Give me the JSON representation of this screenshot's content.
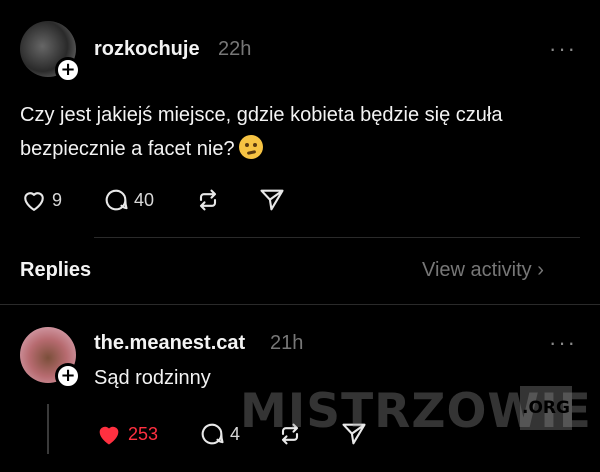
{
  "post": {
    "username": "rozkochuje",
    "time": "22h",
    "text": "Czy jest jakiejś miejsce, gdzie kobieta będzie się czuła bezpiecznie a facet nie?",
    "emoji": "thinking-face",
    "likes": "9",
    "comments": "40",
    "more_label": "···"
  },
  "replies_header": {
    "label": "Replies",
    "view_activity": "View activity ›"
  },
  "reply": {
    "username": "the.meanest.cat",
    "time": "21h",
    "text": "Sąd rodzinny",
    "likes": "253",
    "comments": "4",
    "more_label": "···",
    "liked": true,
    "like_color": "#ff3040"
  },
  "watermark": {
    "main": "MISTRZOWIE",
    "suffix": ".ORG"
  }
}
